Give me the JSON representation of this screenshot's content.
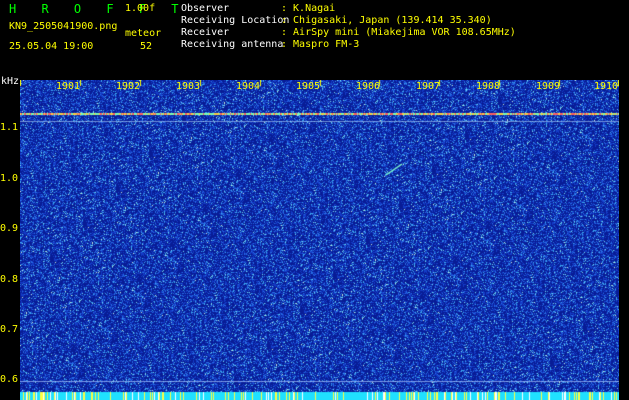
{
  "header": {
    "app_title": "H R O F F T",
    "version": "1.00f",
    "file_name": "KN9_2505041900.png",
    "meteor_label": "meteor",
    "date_time": "25.05.04 19:00",
    "meteor_count": "52",
    "info": [
      {
        "label": "Observer",
        "value": ": K.Nagai"
      },
      {
        "label": "Receiving Location",
        "value": ": Chigasaki, Japan (139.414 35.340)"
      },
      {
        "label": "Receiver",
        "value": ": AirSpy mini (Miakejima VOR 108.65MHz)"
      },
      {
        "label": "Receiving antenna",
        "value": ": Maspro FM-3"
      }
    ]
  },
  "spectrogram": {
    "y_unit": "kHz",
    "y_ticks": [
      "1.1",
      "1.0",
      "0.9",
      "0.8",
      "0.7",
      "0.6"
    ],
    "y_range": [
      0.58,
      1.17
    ],
    "x_ticks": [
      "1901",
      "1902",
      "1903",
      "1904",
      "1905",
      "1906",
      "1907",
      "1908",
      "1909",
      "1910"
    ],
    "x_range_minutes": [
      0,
      10
    ],
    "signal_line_khz": 1.11,
    "background_color": "#0a1f9a",
    "axis_color": "#ffff00"
  }
}
